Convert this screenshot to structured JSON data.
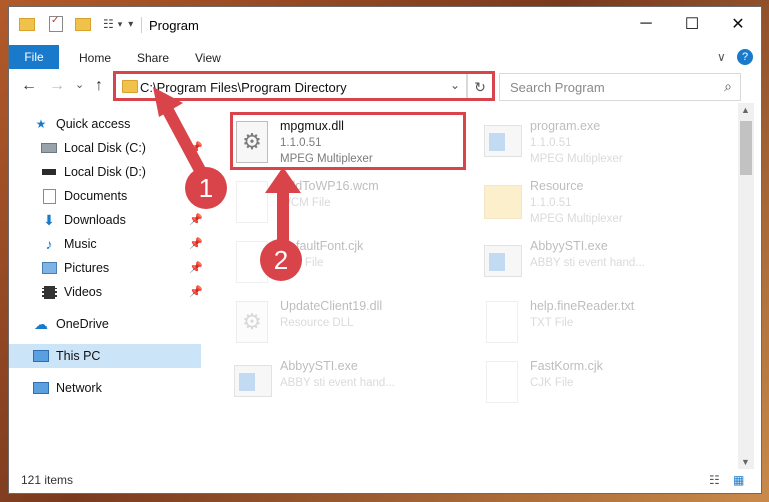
{
  "window": {
    "title": "Program"
  },
  "window_controls": {
    "minimize": "─",
    "maximize": "☐",
    "close": "✕"
  },
  "ribbon": {
    "tabs": [
      "File",
      "Home",
      "Share",
      "View"
    ],
    "help": "?",
    "collapse": "∨"
  },
  "address": {
    "path": "C:\\Program Files\\Program Directory",
    "refresh": "↻",
    "dropdown": "⌄"
  },
  "search": {
    "placeholder": "Search Program",
    "icon": "⌕"
  },
  "nav": {
    "back": "←",
    "forward": "→",
    "recent": "⌄",
    "up": "↑"
  },
  "sidebar": {
    "items": [
      {
        "label": "Quick access",
        "icon": "star-icon"
      },
      {
        "label": "Local Disk (C:)",
        "icon": "drive-icon"
      },
      {
        "label": "Local Disk (D:)",
        "icon": "drive-icon"
      },
      {
        "label": "Documents",
        "icon": "documents-icon"
      },
      {
        "label": "Downloads",
        "icon": "download-icon"
      },
      {
        "label": "Music",
        "icon": "music-icon"
      },
      {
        "label": "Pictures",
        "icon": "pictures-icon"
      },
      {
        "label": "Videos",
        "icon": "videos-icon"
      },
      {
        "label": "OneDrive",
        "icon": "cloud-icon"
      },
      {
        "label": "This PC",
        "icon": "pc-icon"
      },
      {
        "label": "Network",
        "icon": "network-icon"
      }
    ]
  },
  "files": [
    {
      "name": "mpgmux.dll",
      "line2": "1.1.0.51",
      "line3": "MPEG Multiplexer"
    },
    {
      "name": "program.exe",
      "line2": "1.1.0.51",
      "line3": "MPEG Multiplexer"
    },
    {
      "name": "AddToWP16.wcm",
      "line2": "WCM File",
      "line3": ""
    },
    {
      "name": "Resource",
      "line2": "1.1.0.51",
      "line3": "MPEG Multiplexer"
    },
    {
      "name": "DefaultFont.cjk",
      "line2": "CJK File",
      "line3": ""
    },
    {
      "name": "AbbyySTI.exe",
      "line2": "ABBY sti event hand...",
      "line3": ""
    },
    {
      "name": "UpdateClient19.dll",
      "line2": "Resource DLL",
      "line3": ""
    },
    {
      "name": "help.fineReader.txt",
      "line2": "TXT File",
      "line3": ""
    },
    {
      "name": "AbbyySTI.exe",
      "line2": "ABBY sti event hand...",
      "line3": ""
    },
    {
      "name": "FastKorm.cjk",
      "line2": "CJK File",
      "line3": ""
    }
  ],
  "annotations": {
    "step1": "1",
    "step2": "2"
  },
  "status": {
    "items_count": "121 items"
  },
  "colors": {
    "accent": "#1979ca",
    "annotation": "#d9434a"
  }
}
